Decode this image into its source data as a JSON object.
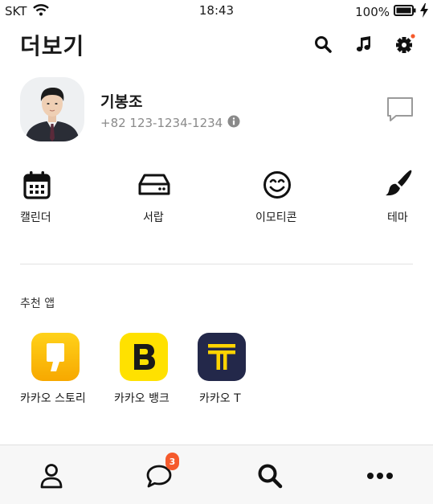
{
  "status": {
    "carrier": "SKT",
    "time": "18:43",
    "battery": "100%",
    "icons": [
      "wifi-icon",
      "battery-icon",
      "charging-icon"
    ]
  },
  "header": {
    "title": "더보기",
    "icons": [
      "search-icon",
      "music-icon",
      "settings-icon"
    ],
    "settings_dot_color": "#f55a2c"
  },
  "profile": {
    "name": "기봉조",
    "phone": "+82 123-1234-1234"
  },
  "quick_menu": [
    {
      "label": "캘린더",
      "icon": "calendar-icon"
    },
    {
      "label": "서랍",
      "icon": "drawer-icon"
    },
    {
      "label": "이모티콘",
      "icon": "emoticon-icon"
    },
    {
      "label": "테마",
      "icon": "brush-icon"
    }
  ],
  "recommended": {
    "title": "추천 앱",
    "apps": [
      {
        "label": "카카오 스토리",
        "icon": "kakao-story-icon",
        "color": "#fbb900"
      },
      {
        "label": "카카오 뱅크",
        "icon": "kakao-bank-icon",
        "color": "#ffe100"
      },
      {
        "label": "카카오 T",
        "icon": "kakao-t-icon",
        "color": "#23284a"
      }
    ]
  },
  "tabbar": {
    "tabs": [
      "friends-tab",
      "chats-tab",
      "search-tab",
      "more-tab"
    ],
    "chat_badge": "3",
    "badge_color": "#f55a2c"
  }
}
